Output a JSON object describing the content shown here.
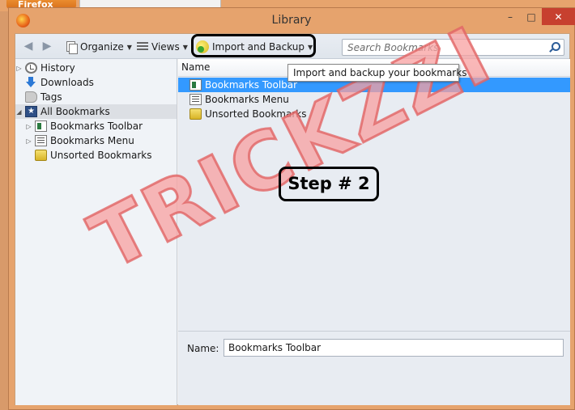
{
  "background": {
    "firefox_button": "Firefox"
  },
  "window": {
    "title": "Library",
    "controls": {
      "minimize": "–",
      "maximize": "□",
      "close": "✕"
    }
  },
  "toolbar": {
    "organize_label": "Organize",
    "views_label": "Views",
    "import_label": "Import and Backup",
    "search_placeholder": "Search Bookmarks"
  },
  "tooltip": "Import and backup your bookmarks",
  "sidebar": {
    "items": [
      {
        "label": "History"
      },
      {
        "label": "Downloads"
      },
      {
        "label": "Tags"
      },
      {
        "label": "All Bookmarks"
      },
      {
        "label": "Bookmarks Toolbar"
      },
      {
        "label": "Bookmarks Menu"
      },
      {
        "label": "Unsorted Bookmarks"
      }
    ]
  },
  "list": {
    "column_name": "Name",
    "rows": [
      {
        "label": "Bookmarks Toolbar"
      },
      {
        "label": "Bookmarks Menu"
      },
      {
        "label": "Unsorted Bookmarks"
      }
    ]
  },
  "detail": {
    "name_label": "Name:",
    "name_value": "Bookmarks Toolbar"
  },
  "annotation": {
    "step": "Step # 2",
    "watermark": "TRICKZZI"
  },
  "colors": {
    "selection": "#3399ff",
    "close_button": "#c7402f",
    "window_frame": "#e6a36d"
  }
}
